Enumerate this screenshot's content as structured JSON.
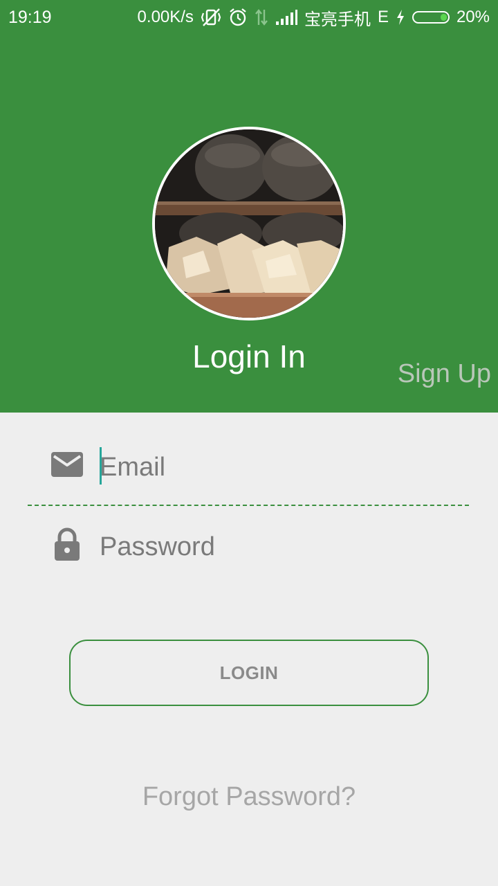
{
  "status_bar": {
    "time": "19:19",
    "net_speed": "0.00K/s",
    "carrier": "宝亮手机",
    "network_type": "E",
    "battery_percent": "20%",
    "battery_level": 0.2,
    "icons": [
      "vibrate-off-icon",
      "alarm-icon",
      "data-arrows-icon",
      "signal-icon",
      "charging-bolt-icon",
      "battery-icon"
    ]
  },
  "header": {
    "title": "Login In",
    "signup_label": "Sign Up",
    "avatar": "cheese-photo"
  },
  "form": {
    "email_placeholder": "Email",
    "email_icon": "mail-icon",
    "password_placeholder": "Password",
    "password_icon": "lock-icon",
    "login_label": "LOGIN",
    "forgot_label": "Forgot Password?"
  },
  "colors": {
    "primary": "#3a8f3e",
    "background": "#eeeeee",
    "cursor": "#26a69a",
    "hint_text": "#7a7a7a"
  }
}
